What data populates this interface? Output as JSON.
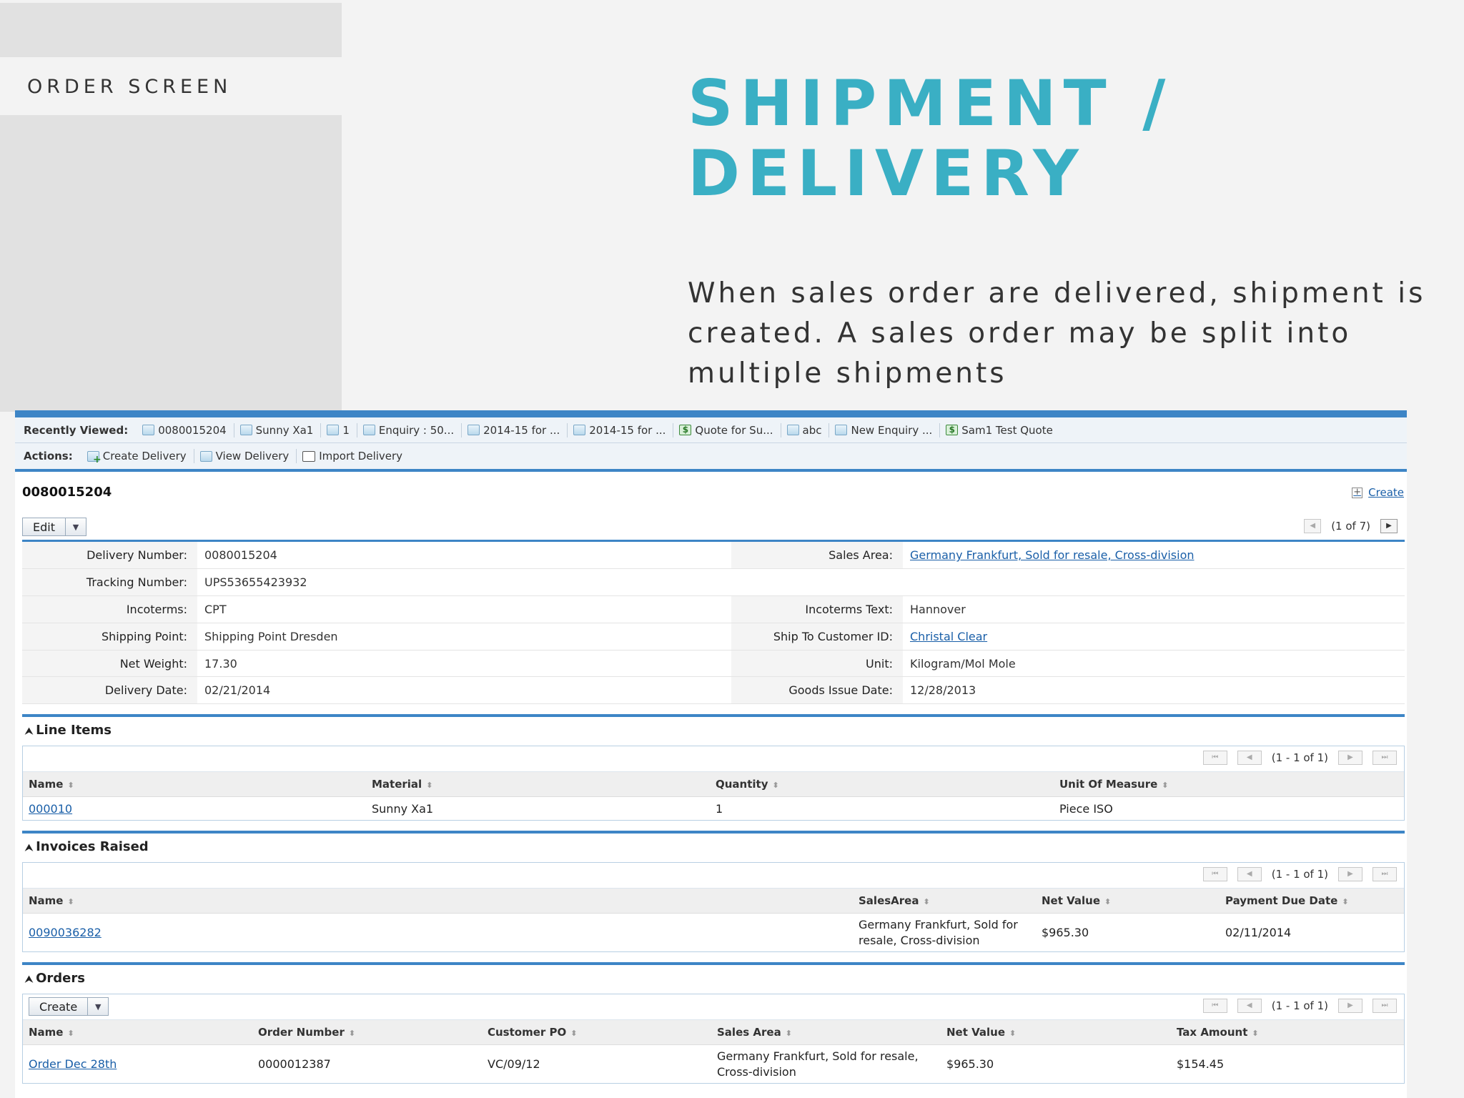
{
  "slide": {
    "section_label": "ORDER SCREEN",
    "title_line1": "SHIPMENT /",
    "title_line2": "DELIVERY",
    "description": "When sales order are delivered, shipment is created. A sales order may be split into multiple shipments"
  },
  "toolbar": {
    "recently_viewed_label": "Recently Viewed:",
    "recently_viewed": [
      {
        "label": "0080015204",
        "icon": "document-icon"
      },
      {
        "label": "Sunny Xa1",
        "icon": "document-icon"
      },
      {
        "label": "1",
        "icon": "document-icon"
      },
      {
        "label": "Enquiry : 50...",
        "icon": "document-icon"
      },
      {
        "label": "2014-15 for ...",
        "icon": "document-icon"
      },
      {
        "label": "2014-15 for ...",
        "icon": "document-icon"
      },
      {
        "label": "Quote for Su...",
        "icon": "quote-icon"
      },
      {
        "label": "abc",
        "icon": "document-icon"
      },
      {
        "label": "New Enquiry ...",
        "icon": "document-icon"
      },
      {
        "label": "Sam1 Test Quote",
        "icon": "quote-icon"
      }
    ],
    "actions_label": "Actions:",
    "actions": [
      "Create Delivery",
      "View Delivery",
      "Import Delivery"
    ]
  },
  "record": {
    "title": "0080015204",
    "create_link": "Create",
    "edit_button": "Edit",
    "pager": "(1 of 7)"
  },
  "details": {
    "rows": [
      {
        "k1": "Delivery Number:",
        "v1": "0080015204",
        "k2": "Sales Area:",
        "v2": "Germany Frankfurt, Sold for resale, Cross-division"
      },
      {
        "k1": "Tracking Number:",
        "v1": "UPS53655423932",
        "k2": "",
        "v2": ""
      },
      {
        "k1": "Incoterms:",
        "v1": "CPT",
        "k2": "Incoterms Text:",
        "v2": "Hannover"
      },
      {
        "k1": "Shipping Point:",
        "v1": "Shipping Point Dresden",
        "k2": "Ship To Customer ID:",
        "v2": "Christal Clear"
      },
      {
        "k1": "Net Weight:",
        "v1": "17.30",
        "k2": "Unit:",
        "v2": "Kilogram/Mol Mole"
      },
      {
        "k1": "Delivery Date:",
        "v1": "02/21/2014",
        "k2": "Goods Issue Date:",
        "v2": "12/28/2013"
      }
    ]
  },
  "line_items": {
    "title": "Line Items",
    "pager": "(1 - 1 of 1)",
    "columns": [
      "Name",
      "Material",
      "Quantity",
      "Unit Of Measure"
    ],
    "rows": [
      [
        "000010",
        "Sunny Xa1",
        "1",
        "Piece ISO"
      ]
    ]
  },
  "invoices": {
    "title": "Invoices Raised",
    "pager": "(1 - 1 of 1)",
    "columns": [
      "Name",
      "SalesArea",
      "Net Value",
      "Payment Due Date"
    ],
    "rows": [
      [
        "0090036282",
        "Germany Frankfurt, Sold for resale, Cross-division",
        "$965.30",
        "02/11/2014"
      ]
    ]
  },
  "orders": {
    "title": "Orders",
    "create_button": "Create",
    "pager": "(1 - 1 of 1)",
    "columns": [
      "Name",
      "Order Number",
      "Customer PO",
      "Sales Area",
      "Net Value",
      "Tax Amount"
    ],
    "rows": [
      [
        "Order Dec 28th",
        "0000012387",
        "VC/09/12",
        "Germany Frankfurt, Sold for resale, Cross-division",
        "$965.30",
        "$154.45"
      ]
    ]
  }
}
